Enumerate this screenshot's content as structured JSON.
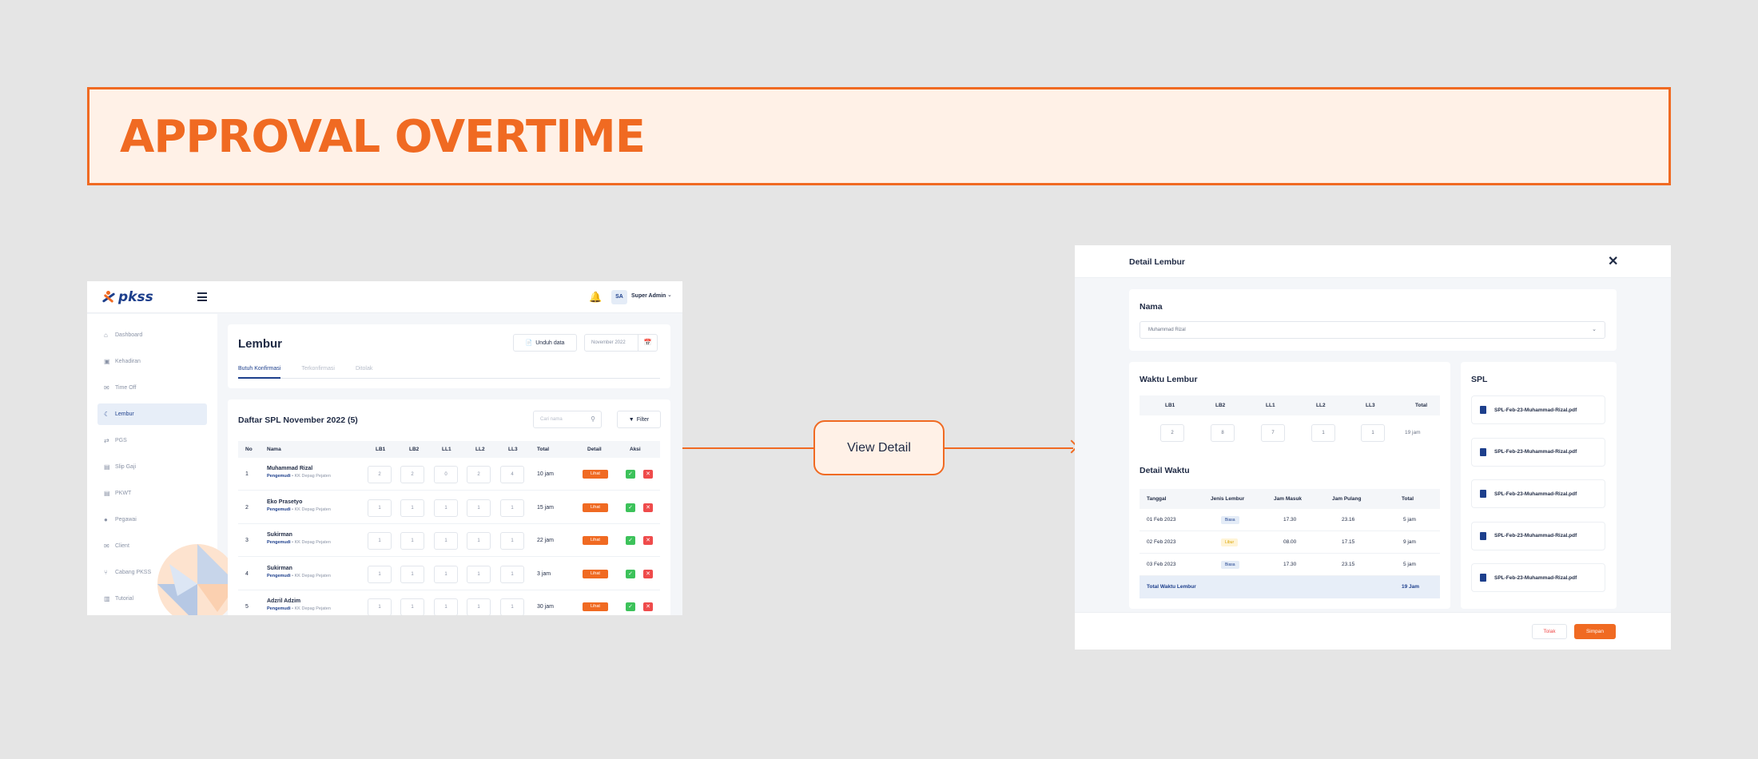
{
  "banner": {
    "title": "APPROVAL OVERTIME"
  },
  "app": {
    "logo_text": "pkss",
    "user": {
      "initials": "SA",
      "name": "Super Admin"
    },
    "sidebar": [
      {
        "label": "Dashboard",
        "icon": "home-icon"
      },
      {
        "label": "Kehadiran",
        "icon": "calendar-icon"
      },
      {
        "label": "Time Off",
        "icon": "mail-icon"
      },
      {
        "label": "Lembur",
        "icon": "moon-icon",
        "active": true
      },
      {
        "label": "PGS",
        "icon": "swap-icon"
      },
      {
        "label": "Slip Gaji",
        "icon": "document-icon"
      },
      {
        "label": "PKWT",
        "icon": "file-icon"
      },
      {
        "label": "Pegawai",
        "icon": "user-icon"
      },
      {
        "label": "Client",
        "icon": "mail-icon"
      },
      {
        "label": "Cabang PKSS",
        "icon": "branch-icon"
      },
      {
        "label": "Tutorial",
        "icon": "book-icon"
      }
    ],
    "page_title": "Lembur",
    "download_label": "Unduh data",
    "date_value": "November 2022",
    "tabs": [
      "Butuh Konfirmasi",
      "Terkonfirmasi",
      "Ditolak"
    ],
    "table": {
      "title": "Daftar SPL November 2022 (5)",
      "search_placeholder": "Cari nama",
      "filter_label": "Filter",
      "headers": [
        "No",
        "Nama",
        "LB1",
        "LB2",
        "LL1",
        "LL2",
        "LL3",
        "Total",
        "Detail",
        "Aksi"
      ],
      "view_label": "Lihat",
      "rows": [
        {
          "no": "1",
          "name": "Muhammad Rizal",
          "role": "Pengemudi",
          "loc": "KK Depag Pejaten",
          "vals": [
            "2",
            "2",
            "0",
            "2",
            "4"
          ],
          "total": "10 jam"
        },
        {
          "no": "2",
          "name": "Eko Prasetyo",
          "role": "Pengemudi",
          "loc": "KK Depag Pejaten",
          "vals": [
            "1",
            "1",
            "1",
            "1",
            "1"
          ],
          "total": "15 jam"
        },
        {
          "no": "3",
          "name": "Sukirman",
          "role": "Pengemudi",
          "loc": "KK Depag Pejaten",
          "vals": [
            "1",
            "1",
            "1",
            "1",
            "1"
          ],
          "total": "22 jam"
        },
        {
          "no": "4",
          "name": "Sukirman",
          "role": "Pengemudi",
          "loc": "KK Depag Pejaten",
          "vals": [
            "1",
            "1",
            "1",
            "1",
            "1"
          ],
          "total": "3 jam"
        },
        {
          "no": "5",
          "name": "Adzril Adzim",
          "role": "Pengemudi",
          "loc": "KK Depag Pejaten",
          "vals": [
            "1",
            "1",
            "1",
            "1",
            "1"
          ],
          "total": "30 jam"
        }
      ]
    }
  },
  "connector": {
    "label": "View Detail"
  },
  "modal": {
    "title": "Detail Lembur",
    "nama_label": "Nama",
    "nama_value": "Muhammad Rizal",
    "waktu_title": "Waktu Lembur",
    "waktu_headers": [
      "LB1",
      "LB2",
      "LL1",
      "LL2",
      "LL3",
      "Total"
    ],
    "waktu_values": [
      "2",
      "8",
      "7",
      "1",
      "1"
    ],
    "waktu_total": "19 jam",
    "detail_title": "Detail Waktu",
    "detail_headers": [
      "Tanggal",
      "Jenis Lembur",
      "Jam Masuk",
      "Jam Pulang",
      "Total"
    ],
    "detail_rows": [
      {
        "date": "01 Feb 2023",
        "type": "Biasa",
        "kind": "biasa",
        "in": "17.30",
        "out": "23.16",
        "total": "5 jam"
      },
      {
        "date": "02 Feb 2023",
        "type": "Libur",
        "kind": "libur",
        "in": "08.00",
        "out": "17.15",
        "total": "9 jam"
      },
      {
        "date": "03 Feb 2023",
        "type": "Biasa",
        "kind": "biasa",
        "in": "17.30",
        "out": "23.15",
        "total": "5 jam"
      }
    ],
    "total_label": "Total Waktu Lembur",
    "total_value": "19 Jam",
    "spl_title": "SPL",
    "spl_files": [
      "SPL-Feb-23-Muhammad-Rizal.pdf",
      "SPL-Feb-23-Muhammad-Rizal.pdf",
      "SPL-Feb-23-Muhammad-Rizal.pdf",
      "SPL-Feb-23-Muhammad-Rizal.pdf",
      "SPL-Feb-23-Muhammad-Rizal.pdf"
    ],
    "reject_label": "Tolak",
    "save_label": "Simpan"
  },
  "colors": {
    "accent": "#f06a22",
    "primary": "#1d3f8c",
    "success": "#3cc25a",
    "danger": "#ef4b4b"
  }
}
